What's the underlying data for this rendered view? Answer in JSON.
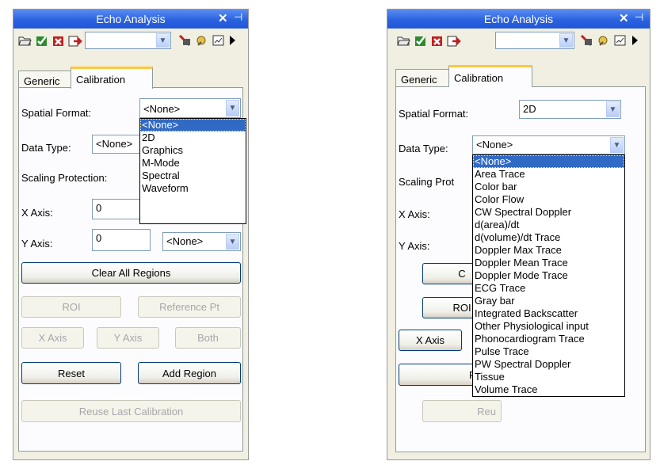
{
  "panel1": {
    "title": "Echo Analysis",
    "close_glyph": "✕",
    "pin_glyph": "⊣",
    "toolbar": {
      "icons": [
        "open-folder-icon",
        "check-icon",
        "delete-icon",
        "export-icon",
        "tool-a-icon",
        "tool-b-icon",
        "edit-icon",
        "more-arrow-icon"
      ],
      "combo_value": ""
    },
    "tabs": [
      "Generic",
      "Calibration"
    ],
    "fields": {
      "spatial_format_label": "Spatial Format:",
      "spatial_format_value": "<None>",
      "data_type_label": "Data Type:",
      "data_type_value": "<None>",
      "scaling_protection_label": "Scaling Protection:",
      "x_axis_label": "X Axis:",
      "x_axis_value": "0",
      "y_axis_label": "Y Axis:",
      "y_axis_value": "0",
      "y_axis_unit": "<None>"
    },
    "buttons": {
      "clear_all": "Clear All Regions",
      "roi": "ROI",
      "reference_pt": "Reference Pt",
      "x_axis": "X Axis",
      "y_axis": "Y Axis",
      "both": "Both",
      "reset": "Reset",
      "add_region": "Add Region",
      "reuse_last": "Reuse Last Calibration"
    },
    "dropdown_options": [
      "<None>",
      "2D",
      "Graphics",
      "M-Mode",
      "Spectral",
      "Waveform"
    ]
  },
  "panel2": {
    "title": "Echo Analysis",
    "close_glyph": "✕",
    "pin_glyph": "⊣",
    "toolbar": {
      "combo_value": ""
    },
    "tabs": [
      "Generic",
      "Calibration"
    ],
    "fields": {
      "spatial_format_label": "Spatial Format:",
      "spatial_format_value": "2D",
      "data_type_label": "Data Type:",
      "data_type_value": "<None>",
      "scaling_protection_label": "Scaling Prot",
      "x_axis_label": "X Axis:",
      "y_axis_label": "Y Axis:"
    },
    "buttons": {
      "clear_all_partial": "C",
      "roi": "ROI",
      "x_axis": "X Axis",
      "reset": "Reset",
      "reuse_partial": "Reu"
    },
    "dropdown_options": [
      "<None>",
      "Area Trace",
      "Color bar",
      "Color Flow",
      "CW Spectral Doppler",
      "d(area)/dt",
      "d(volume)/dt Trace",
      "Doppler Max Trace",
      "Doppler Mean Trace",
      "Doppler Mode Trace",
      "ECG Trace",
      "Gray bar",
      "Integrated Backscatter",
      "Other Physiological input",
      "Phonocardiogram Trace",
      "Pulse Trace",
      "PW Spectral Doppler",
      "Tissue",
      "Volume Trace"
    ]
  }
}
